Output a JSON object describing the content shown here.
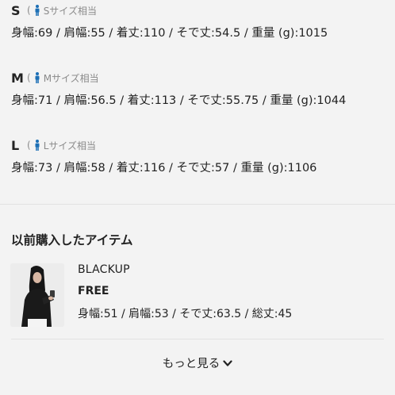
{
  "sizes": [
    {
      "letter": "S",
      "hint": "Sサイズ相当",
      "measure": "身幅:69 / 肩幅:55 / 着丈:110 / そで丈:54.5 / 重量 (g):1015"
    },
    {
      "letter": "M",
      "hint": "Mサイズ相当",
      "measure": "身幅:71 / 肩幅:56.5 / 着丈:113 / そで丈:55.75 / 重量 (g):1044"
    },
    {
      "letter": "L",
      "hint": "Lサイズ相当",
      "measure": "身幅:73 / 肩幅:58 / 着丈:116 / そで丈:57 / 重量 (g):1106"
    }
  ],
  "paren_open": "(",
  "colors": {
    "person_icon": "#1c6fb5",
    "hint_text": "#8a8a8a",
    "background": "#f3f3f3"
  },
  "purchased": {
    "title": "以前購入したアイテム",
    "item": {
      "brand": "BLACKUP",
      "size": "FREE",
      "measure": "身幅:51 / 肩幅:53 / そで丈:63.5 / 総丈:45",
      "thumbnail_icon": "person-photo"
    }
  },
  "more_button": {
    "label": "もっと見る",
    "icon": "chevron-down-icon"
  }
}
